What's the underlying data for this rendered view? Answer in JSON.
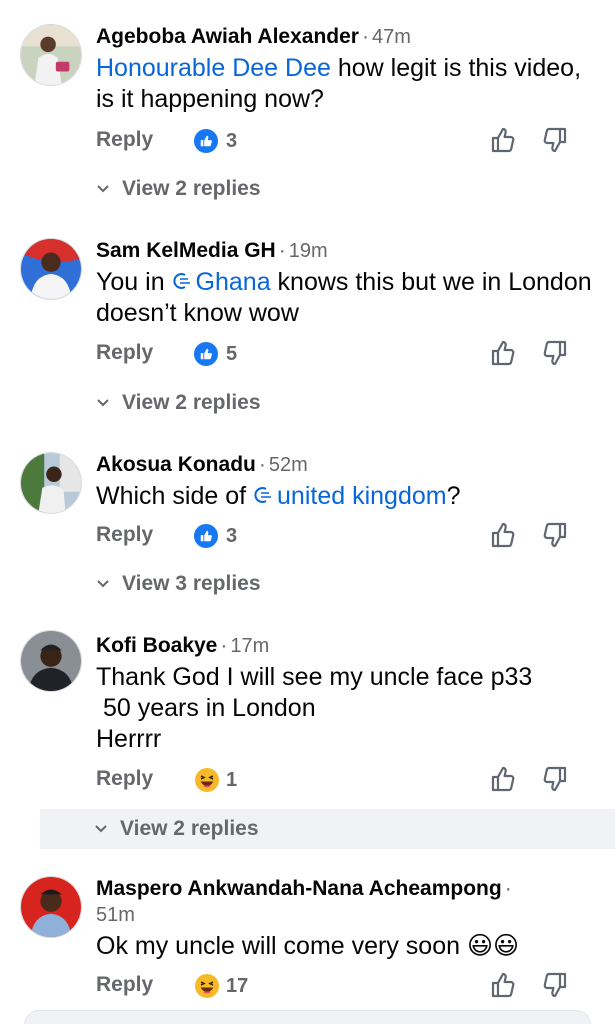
{
  "comments": [
    {
      "name": "Ageboba Awiah Alexander",
      "time": "47m",
      "mention": "Honourable Dee Dee",
      "text_after": " how legit is this video, is it happening now?",
      "reply_label": "Reply",
      "reaction": "like",
      "reaction_count": "3",
      "view_replies": "View 2 replies"
    },
    {
      "name": "Sam KelMedia GH",
      "time": "19m",
      "text_before": "You in ",
      "tag": "Ghana",
      "text_after": " knows this but we in London doesn’t know wow",
      "reply_label": "Reply",
      "reaction": "like",
      "reaction_count": "5",
      "view_replies": "View 2 replies"
    },
    {
      "name": "Akosua Konadu",
      "time": "52m",
      "text_before": "Which side of ",
      "tag": "united kingdom",
      "text_after": "?",
      "reply_label": "Reply",
      "reaction": "like",
      "reaction_count": "3",
      "view_replies": "View 3 replies"
    },
    {
      "name": "Kofi Boakye",
      "time": "17m",
      "text_line1": "Thank God I will see my uncle face p33",
      "text_line2": " 50 years in London",
      "text_line3": "Herrrr",
      "reply_label": "Reply",
      "reaction": "haha",
      "reaction_count": "1",
      "view_replies": "View 2 replies"
    },
    {
      "name": "Maspero Ankwandah-Nana Acheampong",
      "time": "51m",
      "text": "Ok my uncle will come very soon 😃😃",
      "reply_label": "Reply",
      "reaction": "haha",
      "reaction_count": "17"
    }
  ],
  "colors": {
    "mention": "#0866d9",
    "secondary_text": "#65676b",
    "like_blue": "#1877f2"
  },
  "icons": [
    "like-reaction-icon",
    "haha-reaction-icon",
    "upvote-icon",
    "downvote-icon",
    "chevron-down-icon",
    "hashtag-search-icon"
  ]
}
